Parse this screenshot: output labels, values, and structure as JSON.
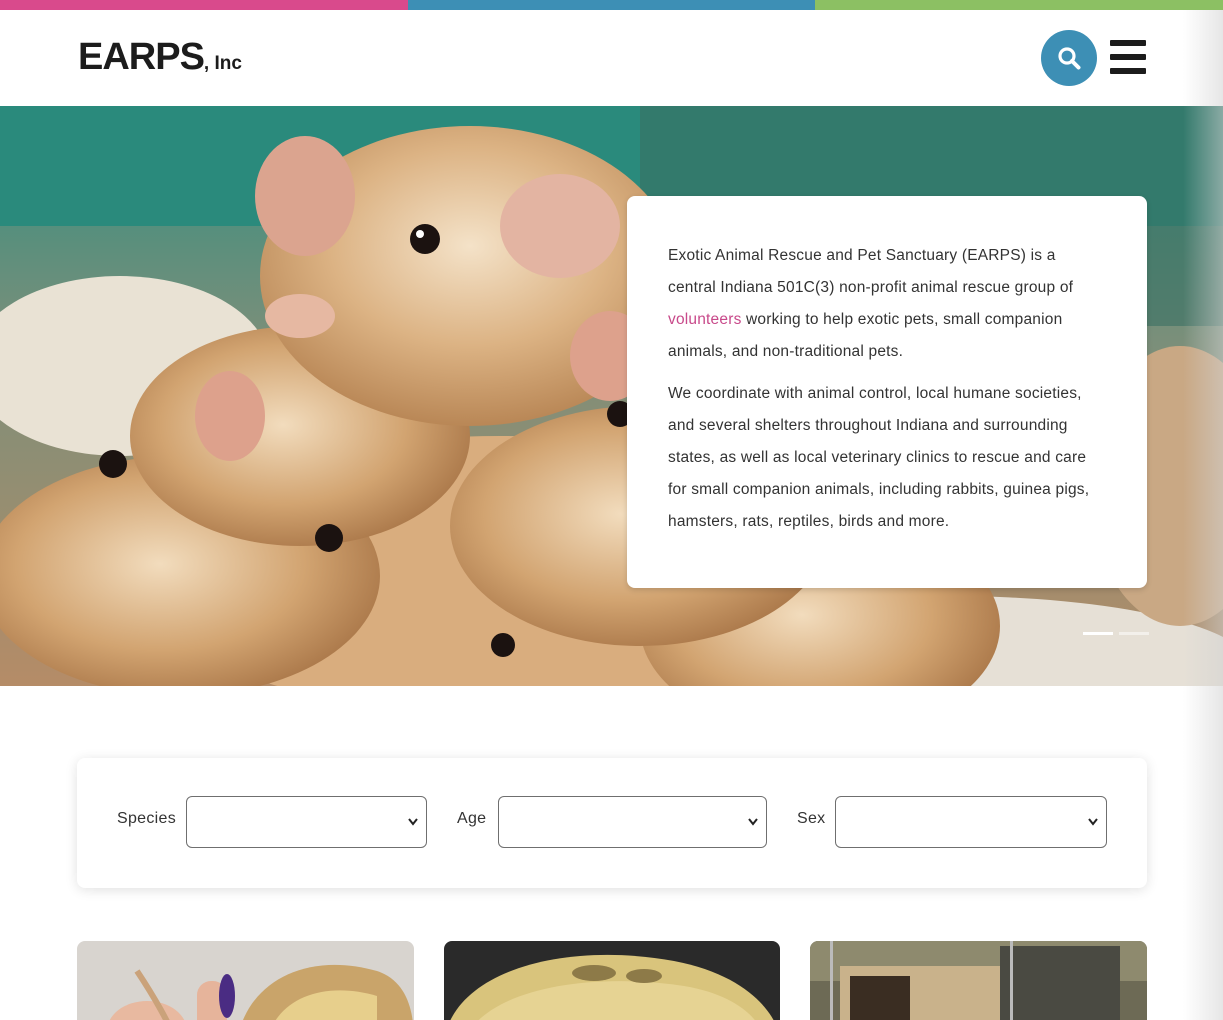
{
  "brand": {
    "name": "EARPS",
    "suffix": ", Inc",
    "colors": {
      "pink": "#d94a8c",
      "blue": "#3d8fb5",
      "green": "#8cc063"
    }
  },
  "header": {
    "search_icon": "search-icon",
    "menu_icon": "hamburger-menu-icon"
  },
  "hero": {
    "image": "gerbils-photo",
    "paragraph1_before": "Exotic Animal Rescue and Pet Sanctuary (EARPS) is a central Indiana 501C(3) non-profit animal rescue group of ",
    "link_volunteers": "volunteers",
    "paragraph1_after": " working to help exotic pets, small companion animals, and non-traditional pets.",
    "paragraph2": "We coordinate with animal control, local humane societies, and several shelters throughout Indiana and surrounding states, as well as local veterinary clinics to rescue and care for small companion animals, including rabbits, guinea pigs, hamsters, rats, reptiles, birds and more.",
    "slides_total": 2,
    "slide_active": 1
  },
  "filters": {
    "species_label": "Species",
    "species_value": "",
    "age_label": "Age",
    "age_value": "",
    "sex_label": "Sex",
    "sex_value": ""
  },
  "pets": [
    {
      "image": "snake-hand-photo"
    },
    {
      "image": "python-photo"
    },
    {
      "image": "enclosure-photo"
    }
  ]
}
